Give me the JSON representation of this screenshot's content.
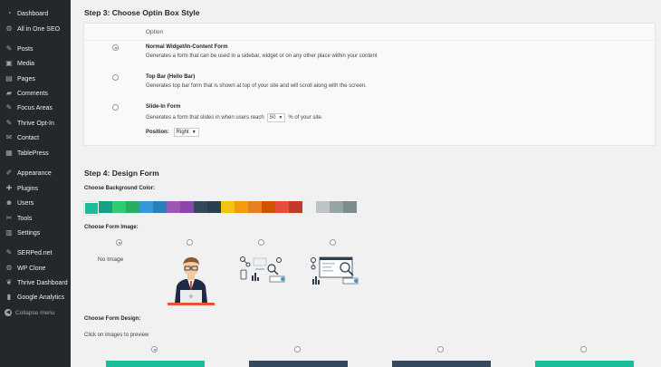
{
  "sidebar": {
    "items": [
      {
        "label": "Dashboard",
        "icon": "dashboard-icon",
        "glyph": "◔"
      },
      {
        "label": "All in One SEO",
        "icon": "gear-icon",
        "glyph": "⚙"
      },
      {
        "label": "Posts",
        "icon": "pin-icon",
        "glyph": "✎"
      },
      {
        "label": "Media",
        "icon": "media-icon",
        "glyph": "▣"
      },
      {
        "label": "Pages",
        "icon": "pages-icon",
        "glyph": "▤"
      },
      {
        "label": "Comments",
        "icon": "comments-icon",
        "glyph": "▰"
      },
      {
        "label": "Focus Areas",
        "icon": "pin-icon",
        "glyph": "✎"
      },
      {
        "label": "Thrive Opt-In",
        "icon": "pin-icon",
        "glyph": "✎"
      },
      {
        "label": "Contact",
        "icon": "mail-icon",
        "glyph": "✉"
      },
      {
        "label": "TablePress",
        "icon": "table-icon",
        "glyph": "▦"
      },
      {
        "label": "Appearance",
        "icon": "brush-icon",
        "glyph": "✐"
      },
      {
        "label": "Plugins",
        "icon": "plugin-icon",
        "glyph": "✚"
      },
      {
        "label": "Users",
        "icon": "users-icon",
        "glyph": "☻"
      },
      {
        "label": "Tools",
        "icon": "wrench-icon",
        "glyph": "✂"
      },
      {
        "label": "Settings",
        "icon": "settings-icon",
        "glyph": "▥"
      },
      {
        "label": "SERPed.net",
        "icon": "pin-icon",
        "glyph": "✎"
      },
      {
        "label": "WP Clone",
        "icon": "gear-icon",
        "glyph": "⚙"
      },
      {
        "label": "Thrive Dashboard",
        "icon": "leaf-icon",
        "glyph": "❦"
      },
      {
        "label": "Google Analytics",
        "icon": "analytics-icon",
        "glyph": "▮"
      }
    ],
    "collapse_label": "Collapse menu"
  },
  "step3": {
    "heading": "Step 3: Choose Optin Box Style",
    "column_header": "Option",
    "options": [
      {
        "title": "Normal Widget/In-Content Form",
        "desc": "Generates a form that can be used in a sidebar, widget or on any other place within your content",
        "checked": true
      },
      {
        "title": "Top Bar (Hello Bar)",
        "desc": "Generates top bar form that is shown at top of your site and will scroll along with the screen.",
        "checked": false
      },
      {
        "title": "Slide-In Form",
        "desc_before": "Generates a form that slides in when users reach",
        "desc_after": "% of your site.",
        "percent_value": "50",
        "checked": false
      }
    ],
    "position_label": "Position:",
    "position_value": "Right"
  },
  "step4": {
    "heading": "Step 4: Design Form",
    "bg_color_label": "Choose Background Color:",
    "colors": [
      "#1abc9c",
      "#16a085",
      "#2ecc71",
      "#27ae60",
      "#3498db",
      "#2980b9",
      "#9b59b6",
      "#8e44ad",
      "#34495e",
      "#2c3e50",
      "#f1c40f",
      "#f39c12",
      "#e67e22",
      "#d35400",
      "#e74c3c",
      "#c0392b",
      "#ecf0f1",
      "#bdc3c7",
      "#95a5a6",
      "#7f8c8d"
    ],
    "selected_color_index": 0,
    "form_image_label": "Choose Form Image:",
    "no_image_label": "No Image",
    "form_design_label": "Choose Form Design:",
    "click_hint": "Click on images to preview",
    "design_colors": [
      "#1abc9c",
      "#34495e",
      "#34495e",
      "#1abc9c"
    ]
  }
}
